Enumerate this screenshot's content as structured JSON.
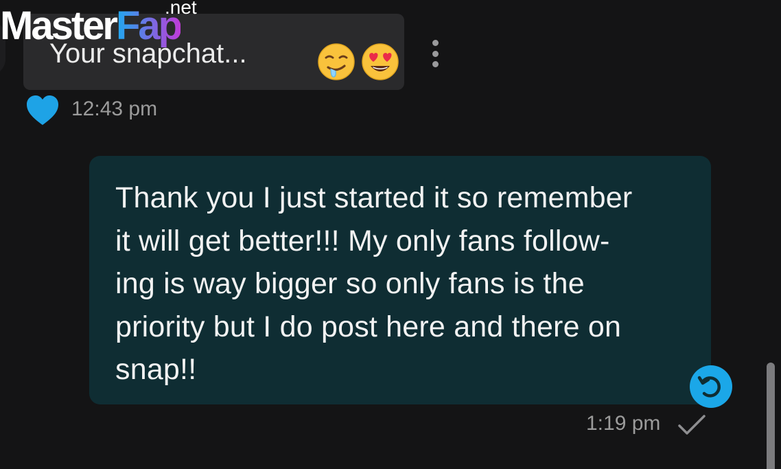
{
  "incoming_message": {
    "text": "Your snapchat...",
    "emojis": [
      "drooling-face-emoji",
      "smiling-face-with-heart-eyes-emoji"
    ],
    "time": "12:43 pm",
    "reaction": "blue-heart-icon"
  },
  "outgoing_message": {
    "lines": [
      "Thank you I just started it so remember",
      "it will get better!!! My only fans follow-",
      "ing is way bigger so only fans is the",
      "priority but I do post here and there on",
      "snap!!"
    ],
    "time": "1:19 pm",
    "status_icon": "check-icon"
  },
  "watermark": {
    "part1": "Master",
    "part2": "Fap",
    "suffix": ".net"
  },
  "colors": {
    "background": "#141415",
    "incoming_bubble": "#2a2a2c",
    "outgoing_bubble": "#0f2d33",
    "accent_blue": "#1ba7e8",
    "timestamp": "#9b9b9b"
  }
}
